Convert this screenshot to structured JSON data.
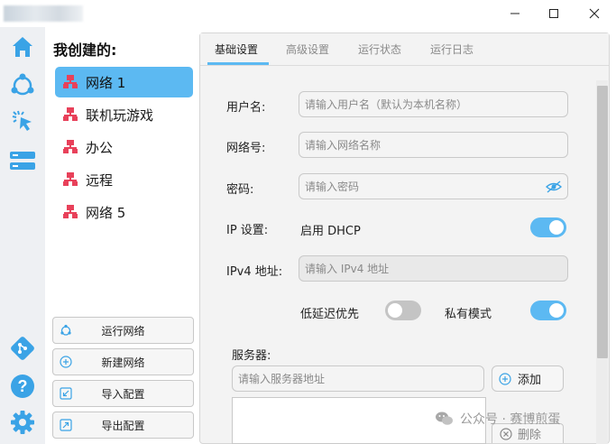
{
  "window": {
    "min_icon": "minimize-icon",
    "max_icon": "maximize-icon",
    "close_icon": "close-icon"
  },
  "sidebar": {
    "icons": [
      "home-icon",
      "network-icon",
      "click-icon",
      "server-icon",
      "git-icon",
      "help-icon",
      "settings-icon"
    ]
  },
  "networks": {
    "title": "我创建的:",
    "items": [
      {
        "label": "网络 1",
        "active": true
      },
      {
        "label": "联机玩游戏",
        "active": false
      },
      {
        "label": "办公",
        "active": false
      },
      {
        "label": "远程",
        "active": false
      },
      {
        "label": "网络 5",
        "active": false
      }
    ],
    "actions": [
      {
        "label": "运行网络",
        "icon": "run-icon"
      },
      {
        "label": "新建网络",
        "icon": "add-icon"
      },
      {
        "label": "导入配置",
        "icon": "import-icon"
      },
      {
        "label": "导出配置",
        "icon": "export-icon"
      }
    ]
  },
  "tabs": [
    {
      "label": "基础设置",
      "active": true
    },
    {
      "label": "高级设置",
      "active": false
    },
    {
      "label": "运行状态",
      "active": false
    },
    {
      "label": "运行日志",
      "active": false
    }
  ],
  "form": {
    "username_label": "用户名:",
    "username_placeholder": "请输入用户名（默认为本机名称）",
    "network_label": "网络号:",
    "network_placeholder": "请输入网络名称",
    "password_label": "密码:",
    "password_placeholder": "请输入密码",
    "ip_label": "IP 设置:",
    "dhcp_label": "启用 DHCP",
    "dhcp_on": true,
    "ipv4_label": "IPv4 地址:",
    "ipv4_placeholder": "请输入 IPv4 地址",
    "latency_label": "低延迟优先",
    "latency_on": false,
    "private_label": "私有模式",
    "private_on": true,
    "server_label": "服务器:",
    "server_placeholder": "请输入服务器地址",
    "add_label": "添加",
    "delete_label": "删除"
  },
  "watermark": {
    "text": "公众号 · 赛博煎蛋"
  },
  "colors": {
    "accent": "#5cb9f2",
    "sidebar_icon": "#3aa3e6",
    "network_icon": "#e8415a",
    "git": "#3aa3e6"
  }
}
